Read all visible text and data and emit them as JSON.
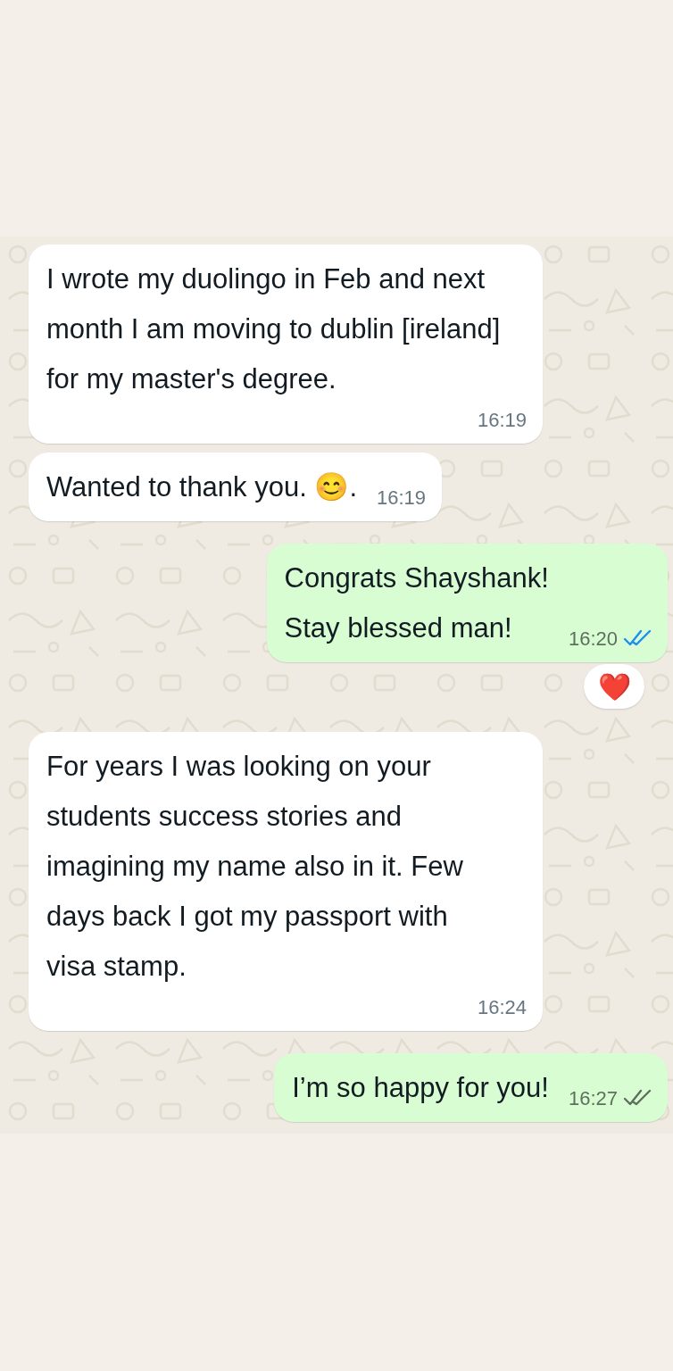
{
  "messages": [
    {
      "kind": "incoming",
      "text": "I wrote my duolingo in Feb and next month I am moving to dublin [ireland] for my master's degree.",
      "time": "16:19"
    },
    {
      "kind": "incoming",
      "text": "Wanted to thank you. 😊.",
      "time": "16:19"
    },
    {
      "kind": "outgoing",
      "text": "Congrats Shayshank!\nStay blessed man!",
      "time": "16:20",
      "read": true,
      "reaction": "❤️"
    },
    {
      "kind": "incoming",
      "text": "For years I was looking on your students success stories and imagining my name also in it. Few days back I got my passport with visa stamp.",
      "time": "16:24"
    },
    {
      "kind": "outgoing",
      "text": "I’m so happy for you!",
      "time": "16:27",
      "read": false
    }
  ]
}
